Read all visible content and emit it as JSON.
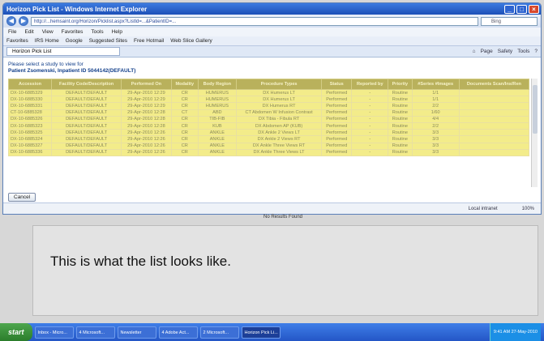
{
  "window": {
    "title": "Horizon Pick List - Windows Internet Explorer",
    "minimize": "_",
    "maximize": "□",
    "close": "×"
  },
  "address": {
    "url": "http://...hemsaint.org/Horizon/Picklist.aspx?ListId=...&PatientID=...",
    "search_placeholder": "Bing"
  },
  "menu": [
    "File",
    "Edit",
    "View",
    "Favorites",
    "Tools",
    "Help"
  ],
  "favorites": [
    "Favorites",
    "IRS Home",
    "Google",
    "Suggested Sites",
    "Free Hotmail",
    "Web Slice Gallery"
  ],
  "tab": {
    "label": "Horizon Pick List"
  },
  "commands": [
    "Page",
    "Safety",
    "Tools"
  ],
  "prompt": "Please select a study to view for",
  "patient": "Patient Zsomenski, Inpatient ID 5044142(DEFAULT)",
  "columns": [
    "Accession",
    "Facility Code/Description",
    "Performed On",
    "Modality",
    "Body Region",
    "Procedure Types",
    "Status",
    "Reported by",
    "Priority",
    "#Series #Images",
    "Documents Scan/Ins/Ren"
  ],
  "rows": [
    [
      "DX-10-6885329",
      "DEFAULT/DEFAULT",
      "29-Apr-2010 12:29",
      "CR",
      "HUMERUS",
      "DX Humerus LT",
      "Performed",
      "-",
      "Routine",
      "1/1",
      ""
    ],
    [
      "DX-10-6885330",
      "DEFAULT/DEFAULT",
      "29-Apr-2010 12:29",
      "CR",
      "HUMERUS",
      "DX Humerus LT",
      "Performed",
      "-",
      "Routine",
      "1/1",
      ""
    ],
    [
      "DX-10-6885331",
      "DEFAULT/DEFAULT",
      "29-Apr-2010 12:29",
      "CR",
      "HUMERUS",
      "DX Humerus RT",
      "Performed",
      "-",
      "Routine",
      "2/2",
      ""
    ],
    [
      "CT-10-6885328",
      "DEFAULT/DEFAULT",
      "29-Apr-2010 12:28",
      "CT",
      "ABD",
      "CT Abdomen W Infusion Contrast",
      "Performed",
      "-",
      "Routine",
      "1/60",
      ""
    ],
    [
      "DX-10-6885326",
      "DEFAULT/DEFAULT",
      "29-Apr-2010 12:28",
      "CR",
      "TIB-FIB",
      "DX Tibia - Fibula RT",
      "Performed",
      "-",
      "Routine",
      "4/4",
      ""
    ],
    [
      "DX-10-6885323",
      "DEFAULT/DEFAULT",
      "29-Apr-2010 12:28",
      "CR",
      "KUB",
      "DX Abdomen AP (KUB)",
      "Performed",
      "-",
      "Routine",
      "2/2",
      ""
    ],
    [
      "DX-10-6885325",
      "DEFAULT/DEFAULT",
      "29-Apr-2010 12:26",
      "CR",
      "ANKLE",
      "DX Ankle 2 Views LT",
      "Performed",
      "-",
      "Routine",
      "3/3",
      ""
    ],
    [
      "DX-10-6885324",
      "DEFAULT/DEFAULT",
      "29-Apr-2010 12:26",
      "CR",
      "ANKLE",
      "DX Ankle 2 Views RT",
      "Performed",
      "-",
      "Routine",
      "3/3",
      ""
    ],
    [
      "DX-10-6885327",
      "DEFAULT/DEFAULT",
      "29-Apr-2010 12:26",
      "CR",
      "ANKLE",
      "DX Ankle Three Views RT",
      "Performed",
      "-",
      "Routine",
      "3/3",
      ""
    ],
    [
      "DX-10-6885336",
      "DEFAULT/DEFAULT",
      "29-Apr-2010 12:26",
      "CR",
      "ANKLE",
      "DX Ankle Three Views LT",
      "Performed",
      "-",
      "Routine",
      "3/3",
      ""
    ]
  ],
  "cancel": "Cancel",
  "status": {
    "zone": "Local intranet",
    "zoom": "100%"
  },
  "no_results": "No Results Found",
  "caption": "This is what the list looks like.",
  "taskbar": {
    "start": "start",
    "items": [
      "Inbox - Micro...",
      "4 Microsoft...",
      "Newsletter",
      "4 Adobe Act...",
      "2 Microsoft...",
      "Horizon Pick Li..."
    ],
    "clock": "9:41 AM 27-May-2010"
  }
}
